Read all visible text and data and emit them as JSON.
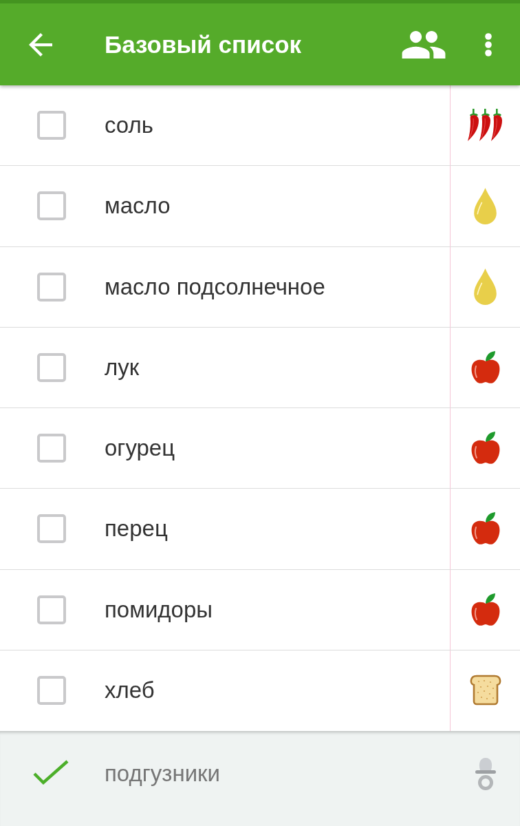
{
  "app_bar": {
    "title": "Базовый список"
  },
  "items": [
    {
      "label": "соль",
      "checked": false,
      "kind": "chili"
    },
    {
      "label": "масло",
      "checked": false,
      "kind": "drop"
    },
    {
      "label": "масло подсолнечное",
      "checked": false,
      "kind": "drop"
    },
    {
      "label": "лук",
      "checked": false,
      "kind": "apple"
    },
    {
      "label": "огурец",
      "checked": false,
      "kind": "apple"
    },
    {
      "label": "перец",
      "checked": false,
      "kind": "apple"
    },
    {
      "label": "помидоры",
      "checked": false,
      "kind": "apple"
    },
    {
      "label": "хлеб",
      "checked": false,
      "kind": "bread"
    }
  ],
  "completed": [
    {
      "label": "подгузники",
      "checked": true,
      "kind": "pacifier"
    }
  ]
}
